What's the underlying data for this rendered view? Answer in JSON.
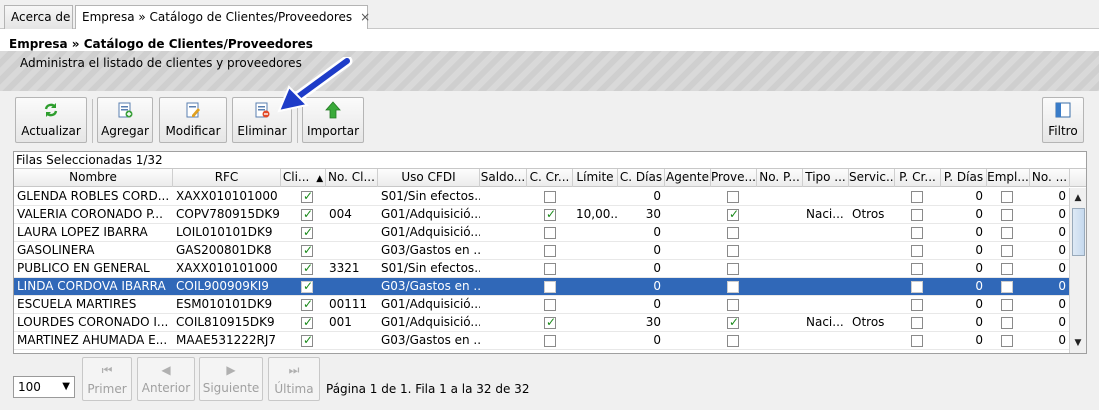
{
  "tabs": [
    {
      "label": "Acerca de"
    },
    {
      "label": "Empresa » Catálogo de Clientes/Proveedores",
      "close": "×"
    }
  ],
  "header": {
    "title": "Empresa » Catálogo de Clientes/Proveedores",
    "subtitle": "Administra el listado de clientes y proveedores"
  },
  "toolbar": {
    "actualizar": "Actualizar",
    "agregar": "Agregar",
    "modificar": "Modificar",
    "eliminar": "Eliminar",
    "importar": "Importar",
    "filtro": "Filtro"
  },
  "grid": {
    "selection_info": "Filas Seleccionadas  1/32",
    "columns": [
      "Nombre",
      "RFC",
      "Cli...",
      "No. Cl...",
      "Uso CFDI",
      "Saldo...",
      "C. Cr...",
      "Límite",
      "C. Días",
      "Agente",
      "Prove...",
      "No. P...",
      "Tipo ...",
      "Servic...",
      "P. Cr...",
      "P. Días",
      "Empl...",
      "No. ..."
    ],
    "sort_indicator": "▲",
    "rows": [
      {
        "nombre": "GLENDA ROBLES CORD...",
        "rfc": "XAXX010101000",
        "cli": true,
        "nocl": "",
        "uso": "S01/Sin efectos...",
        "ccr": false,
        "limite": "",
        "cdias": "0",
        "prov": false,
        "tipo": "",
        "serv": "",
        "pcr": false,
        "pdias": "0",
        "empl": false,
        "no": "0"
      },
      {
        "nombre": "VALERIA CORONADO P...",
        "rfc": "COPV780915DK9",
        "cli": true,
        "nocl": "004",
        "uso": "G01/Adquisició...",
        "ccr": true,
        "limite": "10,00...",
        "cdias": "30",
        "prov": true,
        "tipo": "Naci...",
        "serv": "Otros",
        "pcr": false,
        "pdias": "0",
        "empl": false,
        "no": "0"
      },
      {
        "nombre": "LAURA LOPEZ IBARRA",
        "rfc": "LOIL010101DK9",
        "cli": true,
        "nocl": "",
        "uso": "G01/Adquisició...",
        "ccr": false,
        "limite": "",
        "cdias": "0",
        "prov": false,
        "tipo": "",
        "serv": "",
        "pcr": false,
        "pdias": "0",
        "empl": false,
        "no": "0"
      },
      {
        "nombre": "GASOLINERA",
        "rfc": "GAS200801DK8",
        "cli": true,
        "nocl": "",
        "uso": "G03/Gastos en ...",
        "ccr": false,
        "limite": "",
        "cdias": "0",
        "prov": false,
        "tipo": "",
        "serv": "",
        "pcr": false,
        "pdias": "0",
        "empl": false,
        "no": "0"
      },
      {
        "nombre": "PUBLICO EN GENERAL",
        "rfc": "XAXX010101000",
        "cli": true,
        "nocl": "3321",
        "uso": "S01/Sin efectos...",
        "ccr": false,
        "limite": "",
        "cdias": "0",
        "prov": false,
        "tipo": "",
        "serv": "",
        "pcr": false,
        "pdias": "0",
        "empl": false,
        "no": "0"
      },
      {
        "nombre": "LINDA CORDOVA IBARRA",
        "rfc": "COIL900909KI9",
        "cli": true,
        "nocl": "",
        "uso": "G03/Gastos en ...",
        "ccr": false,
        "limite": "",
        "cdias": "0",
        "prov": false,
        "tipo": "",
        "serv": "",
        "pcr": false,
        "pdias": "0",
        "empl": false,
        "no": "0",
        "selected": true
      },
      {
        "nombre": "ESCUELA MARTIRES",
        "rfc": "ESM010101DK9",
        "cli": true,
        "nocl": "00111",
        "uso": "G01/Adquisició...",
        "ccr": false,
        "limite": "",
        "cdias": "0",
        "prov": false,
        "tipo": "",
        "serv": "",
        "pcr": false,
        "pdias": "0",
        "empl": false,
        "no": "0"
      },
      {
        "nombre": "LOURDES CORONADO I...",
        "rfc": "COIL810915DK9",
        "cli": true,
        "nocl": "001",
        "uso": "G01/Adquisició...",
        "ccr": true,
        "limite": "",
        "cdias": "30",
        "prov": true,
        "tipo": "Naci...",
        "serv": "Otros",
        "pcr": false,
        "pdias": "0",
        "empl": false,
        "no": "0"
      },
      {
        "nombre": "MARTINEZ AHUMADA E...",
        "rfc": "MAAE531222RJ7",
        "cli": true,
        "nocl": "",
        "uso": "G03/Gastos en ...",
        "ccr": false,
        "limite": "",
        "cdias": "0",
        "prov": false,
        "tipo": "",
        "serv": "",
        "pcr": false,
        "pdias": "0",
        "empl": false,
        "no": "0"
      }
    ]
  },
  "pager": {
    "page_size": "100",
    "primer": "Primer",
    "anterior": "Anterior",
    "siguiente": "Siguiente",
    "ultima": "Última",
    "info": "Página 1 de 1. Fila 1 a la 32 de 32"
  },
  "colors": {
    "selected_row": "#3068b8",
    "pointer": "#1e3cc8"
  }
}
